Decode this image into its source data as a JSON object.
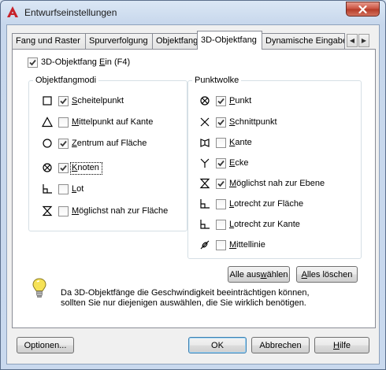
{
  "window": {
    "title": "Entwurfseinstellungen"
  },
  "tabs": [
    {
      "label": "Fang und Raster"
    },
    {
      "label": "Spurverfolgung"
    },
    {
      "label": "Objektfang"
    },
    {
      "label": "3D-Objektfang",
      "active": true
    },
    {
      "label": "Dynamische Eingabe"
    }
  ],
  "main_toggle": {
    "prefix": "3D-Objektfang ",
    "underlined": "E",
    "suffix": "in (F4)",
    "checked": true
  },
  "objektfangmodi": {
    "title": "Objektfangmodi",
    "items": [
      {
        "icon": "square-icon",
        "underlined": "S",
        "rest": "cheitelpunkt",
        "checked": true
      },
      {
        "icon": "triangle-icon",
        "underlined": "M",
        "rest": "ittelpunkt auf Kante",
        "checked": false
      },
      {
        "icon": "circle-icon",
        "underlined": "Z",
        "rest": "entrum auf Fläche",
        "checked": true
      },
      {
        "icon": "knot-icon",
        "underlined": "K",
        "rest": "noten",
        "checked": true
      },
      {
        "icon": "perpendicular-icon",
        "underlined": "L",
        "rest": "ot",
        "checked": false
      },
      {
        "icon": "hourglass-icon",
        "underlined": "M",
        "rest": "öglichst nah zur Fläche",
        "checked": false
      }
    ]
  },
  "punktwolke": {
    "title": "Punktwolke",
    "items": [
      {
        "icon": "knot-icon",
        "underlined": "P",
        "rest": "unkt",
        "checked": true
      },
      {
        "icon": "intersection-icon",
        "underlined": "S",
        "rest": "chnittpunkt",
        "checked": true
      },
      {
        "icon": "edge-icon",
        "underlined": "K",
        "rest": "ante",
        "checked": false
      },
      {
        "icon": "corner-icon",
        "underlined": "E",
        "rest": "cke",
        "checked": true
      },
      {
        "icon": "hourglass-icon",
        "underlined": "M",
        "rest": "öglichst nah zur Ebene",
        "checked": true
      },
      {
        "icon": "perpendicular-icon",
        "underlined": "L",
        "rest": "otrecht zur Fläche",
        "checked": false
      },
      {
        "icon": "perpendicular-icon",
        "underlined": "L",
        "rest": "otrecht zur Kante",
        "checked": false
      },
      {
        "icon": "centerline-icon",
        "underlined": "M",
        "rest": "ittellinie",
        "checked": false
      }
    ]
  },
  "buttons": {
    "select_all": {
      "prefix": "Alle aus",
      "underlined": "w",
      "suffix": "ählen"
    },
    "clear_all": {
      "prefix": "",
      "underlined": "A",
      "suffix": "lles löschen"
    },
    "options": {
      "prefix": "Optionen...",
      "underlined": "",
      "suffix": ""
    },
    "ok": {
      "label": "OK"
    },
    "cancel": {
      "label": "Abbrechen"
    },
    "help": {
      "prefix": "",
      "underlined": "H",
      "suffix": "ilfe"
    }
  },
  "info": {
    "line1": "Da 3D-Objektfänge die Geschwindigkeit beeinträchtigen können,",
    "line2": "sollten Sie nur diejenigen auswählen, die Sie wirklich benötigen."
  },
  "colors": {
    "app_icon": "#c7222a",
    "group_border": "#d5dfe5",
    "default_button_border": "#3c7fb1"
  }
}
